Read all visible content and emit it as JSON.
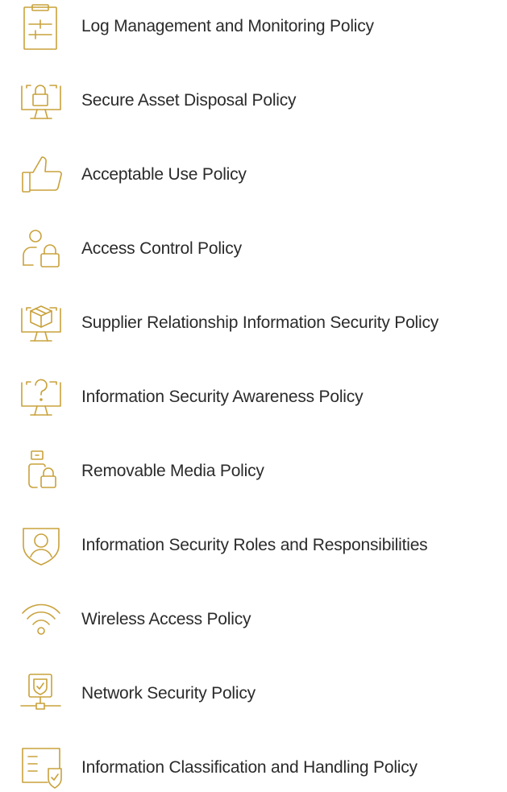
{
  "accent_color": "#C9A23C",
  "text_color": "#2b2b2b",
  "policies": [
    {
      "label": "Log Management and Monitoring Policy",
      "icon": "clipboard-sliders-icon"
    },
    {
      "label": "Secure Asset Disposal Policy",
      "icon": "monitor-lock-icon"
    },
    {
      "label": "Acceptable Use Policy",
      "icon": "thumbs-up-icon"
    },
    {
      "label": "Access Control Policy",
      "icon": "user-lock-icon"
    },
    {
      "label": "Supplier Relationship Information Security Policy",
      "icon": "monitor-box-icon"
    },
    {
      "label": "Information Security Awareness Policy",
      "icon": "monitor-question-icon"
    },
    {
      "label": "Removable Media Policy",
      "icon": "usb-lock-icon"
    },
    {
      "label": "Information Security Roles and Responsibilities",
      "icon": "shield-user-icon"
    },
    {
      "label": "Wireless Access Policy",
      "icon": "wifi-icon"
    },
    {
      "label": "Network Security Policy",
      "icon": "network-shield-icon"
    },
    {
      "label": "Information Classification and Handling Policy",
      "icon": "document-shield-icon"
    }
  ]
}
